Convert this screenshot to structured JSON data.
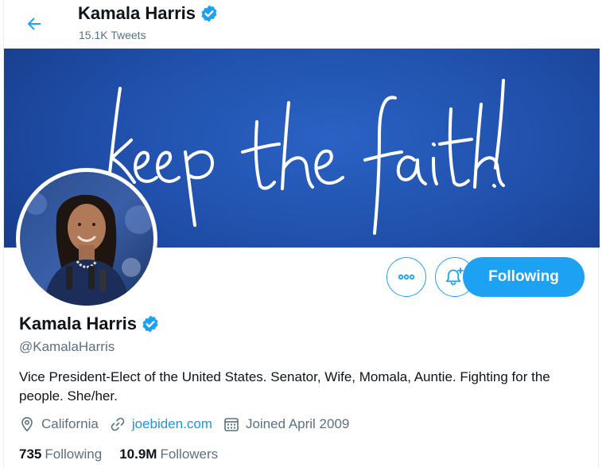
{
  "header": {
    "name": "Kamala Harris",
    "tweet_count": "15.1K Tweets"
  },
  "banner": {
    "text": "keep the faith!"
  },
  "actions": {
    "following_label": "Following"
  },
  "profile": {
    "name": "Kamala Harris",
    "handle": "@KamalaHarris",
    "bio": "Vice President-Elect of the United States. Senator, Wife, Momala, Auntie. Fighting for the people. She/her.",
    "location": "California",
    "website": "joebiden.com",
    "joined": "Joined April 2009"
  },
  "stats": {
    "following_count": "735",
    "following_label": "Following",
    "followers_count": "10.9M",
    "followers_label": "Followers"
  },
  "colors": {
    "accent": "#1da1f2",
    "link": "#1b95e0",
    "verified": "#1da1f2",
    "banner": "#1f4ea8"
  }
}
